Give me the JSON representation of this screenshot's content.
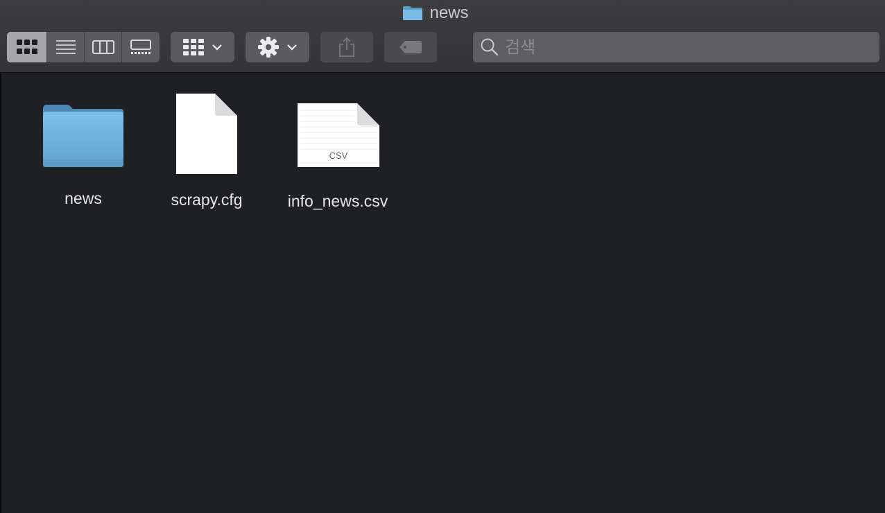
{
  "window": {
    "title": "news",
    "title_icon": "folder-icon"
  },
  "toolbar": {
    "view_modes": [
      {
        "name": "icon-view",
        "icon": "grid-icon",
        "active": true
      },
      {
        "name": "list-view",
        "icon": "list-icon",
        "active": false
      },
      {
        "name": "column-view",
        "icon": "columns-icon",
        "active": false
      },
      {
        "name": "gallery-view",
        "icon": "gallery-icon",
        "active": false
      }
    ],
    "group_button_icon": "group-grid-icon",
    "action_button_icon": "gear-icon",
    "share_button_icon": "share-icon",
    "tag_button_icon": "tag-icon",
    "search": {
      "placeholder": "검색",
      "value": ""
    }
  },
  "files": [
    {
      "name": "news",
      "kind": "folder",
      "icon": "folder-icon"
    },
    {
      "name": "scrapy.cfg",
      "kind": "document",
      "icon": "blank-document-icon"
    },
    {
      "name": "info_news.csv",
      "kind": "csv",
      "icon": "csv-document-icon",
      "badge": "CSV"
    }
  ],
  "colors": {
    "background": "#202124",
    "toolbar": "#3a3a3c",
    "folder_blue": "#6fb2e0",
    "label_text": "#e6e6e8"
  }
}
